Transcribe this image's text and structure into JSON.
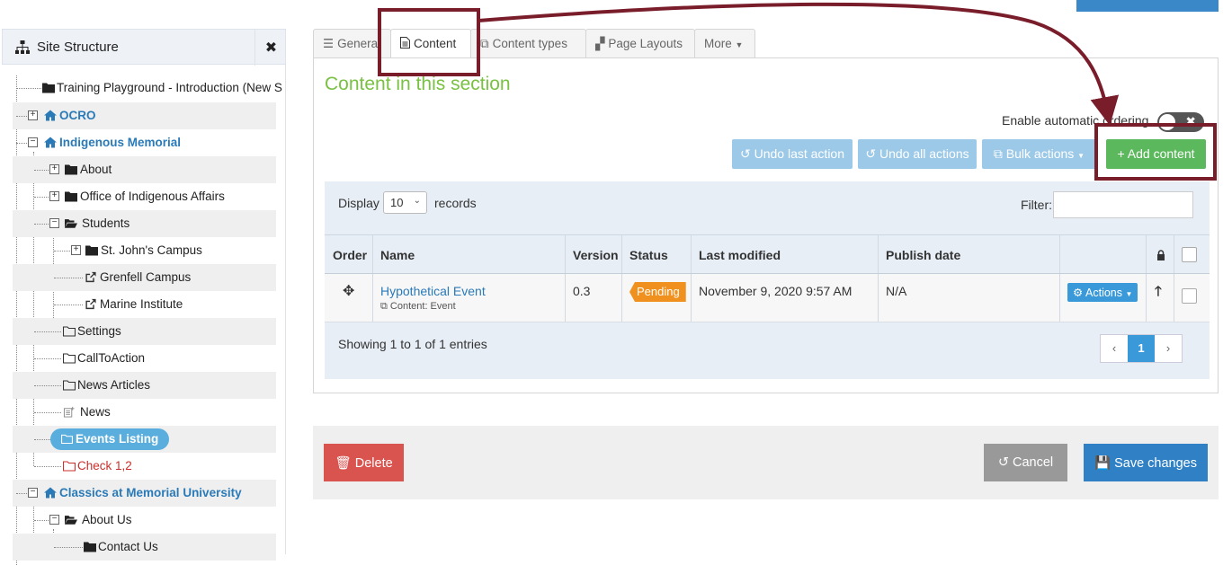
{
  "sidebar": {
    "title": "Site Structure",
    "title_icon": "sitemap-icon",
    "expand_icon": "expand-icon",
    "items": [
      {
        "label": "Training Playground - Introduction (New S",
        "icon": "folder-icon"
      },
      {
        "label": "OCRO",
        "icon": "home-icon"
      },
      {
        "label": "Indigenous Memorial",
        "icon": "home-icon"
      },
      {
        "label": "About",
        "icon": "folder-icon"
      },
      {
        "label": "Office of Indigenous Affairs",
        "icon": "folder-icon"
      },
      {
        "label": "Students",
        "icon": "folder-open-icon"
      },
      {
        "label": "St. John's Campus",
        "icon": "folder-icon"
      },
      {
        "label": "Grenfell Campus",
        "icon": "external-link-icon"
      },
      {
        "label": "Marine Institute",
        "icon": "external-link-icon"
      },
      {
        "label": "Settings",
        "icon": "folder-outline-icon"
      },
      {
        "label": "CallToAction",
        "icon": "folder-outline-icon"
      },
      {
        "label": "News Articles",
        "icon": "folder-outline-icon"
      },
      {
        "label": "News",
        "icon": "news-listing-icon"
      },
      {
        "label": "Events Listing",
        "icon": "folder-outline-icon"
      },
      {
        "label": "Check 1,2",
        "icon": "folder-outline-icon"
      },
      {
        "label": "Classics at Memorial University",
        "icon": "home-icon"
      },
      {
        "label": "About Us",
        "icon": "folder-open-icon"
      },
      {
        "label": "Contact Us",
        "icon": "folder-icon"
      }
    ]
  },
  "tabs": [
    {
      "label": "Genera",
      "icon": "sliders-icon"
    },
    {
      "label": "Content",
      "icon": "document-icon"
    },
    {
      "label": "Content types",
      "icon": "cubes-icon"
    },
    {
      "label": "Page Layouts",
      "icon": "puzzle-icon"
    },
    {
      "label": "More",
      "icon": "caret-down-icon"
    }
  ],
  "content": {
    "section_title": "Content in this section",
    "auto_ordering_label": "Enable automatic ordering",
    "auto_ordering_on": false,
    "buttons": {
      "undo_last": "Undo last action",
      "undo_all": "Undo all actions",
      "bulk": "Bulk actions",
      "add": "+ Add content"
    },
    "display_label": "Display",
    "display_value": "10",
    "records_label": "records",
    "filter_label": "Filter:",
    "filter_value": "",
    "columns": [
      "Order",
      "Name",
      "Version",
      "Status",
      "Last modified",
      "Publish date"
    ],
    "rows": [
      {
        "name": "Hypothetical Event",
        "type": "Content: Event",
        "version": "0.3",
        "status": "Pending",
        "last_modified": "November 9, 2020 9:57 AM",
        "publish_date": "N/A",
        "actions": "Actions"
      }
    ],
    "showing": "Showing 1 to 1 of 1 entries",
    "pager": {
      "prev": "‹",
      "current": "1",
      "next": "›"
    }
  },
  "footer": {
    "delete": "Delete",
    "cancel": "Cancel",
    "save": "Save changes"
  },
  "colors": {
    "accent_blue": "#3a9ad9",
    "green": "#5cb85c",
    "danger": "#d9534f",
    "annotation": "#7a1d2b",
    "title_green": "#7ac143",
    "pending": "#f0901e"
  }
}
